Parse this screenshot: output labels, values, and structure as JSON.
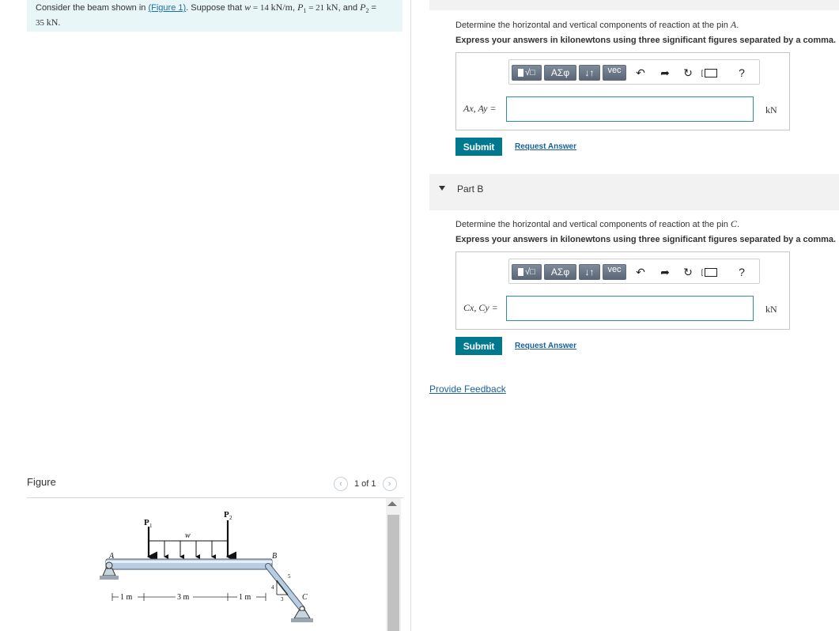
{
  "problem": {
    "pre": "Consider the beam shown in ",
    "figure_link": "(Figure 1)",
    "mid": ". Suppose that ",
    "w_var": "w",
    "w_val": " = 14 ",
    "w_unit": "kN/m",
    "p1_var": "P",
    "p1_sub": "1",
    "p1_val": " = 21 ",
    "p1_unit": "kN",
    "and": ", and ",
    "p2_var": "P",
    "p2_sub": "2",
    "p2_val": " =",
    "line2_val": "35 ",
    "line2_unit": "kN",
    "line2_end": "."
  },
  "figure": {
    "label": "Figure",
    "count": "1 of 1",
    "prev_icon": "chevron-left-icon",
    "next_icon": "chevron-right-icon",
    "labels": {
      "A": "A",
      "B": "B",
      "C": "C",
      "w": "w",
      "P1": "P",
      "P1_sub": "1",
      "P2": "P",
      "P2_sub": "2",
      "dim1": "1 m",
      "dim2": "3 m",
      "dim3": "1 m",
      "tri_a": "4",
      "tri_b": "3",
      "tri_c": "5"
    }
  },
  "part_a": {
    "question_pre": "Determine the horizontal and vertical components of reaction at the pin ",
    "question_var": "A",
    "question_end": ".",
    "instructions": "Express your answers in kilonewtons using three significant figures separated by a comma.",
    "answer_label": "Ax, Ay =",
    "unit": "kN",
    "submit": "Submit",
    "request": "Request Answer"
  },
  "part_b": {
    "title": "Part B",
    "question_pre": "Determine the horizontal and vertical components of reaction at the pin ",
    "question_var": "C",
    "question_end": ".",
    "instructions": "Express your answers in kilonewtons using three significant figures separated by a comma.",
    "answer_label": "Cx, Cy =",
    "unit": "kN",
    "submit": "Submit",
    "request": "Request Answer"
  },
  "toolbar": {
    "templates_icon": "templates-icon",
    "greek": "ΑΣφ",
    "arrows": "↓↑",
    "vec": "vec",
    "undo_icon": "undo-icon",
    "redo_icon": "redo-icon",
    "reset_icon": "reset-icon",
    "keyboard_icon": "keyboard-icon",
    "help": "?"
  },
  "feedback": "Provide Feedback"
}
